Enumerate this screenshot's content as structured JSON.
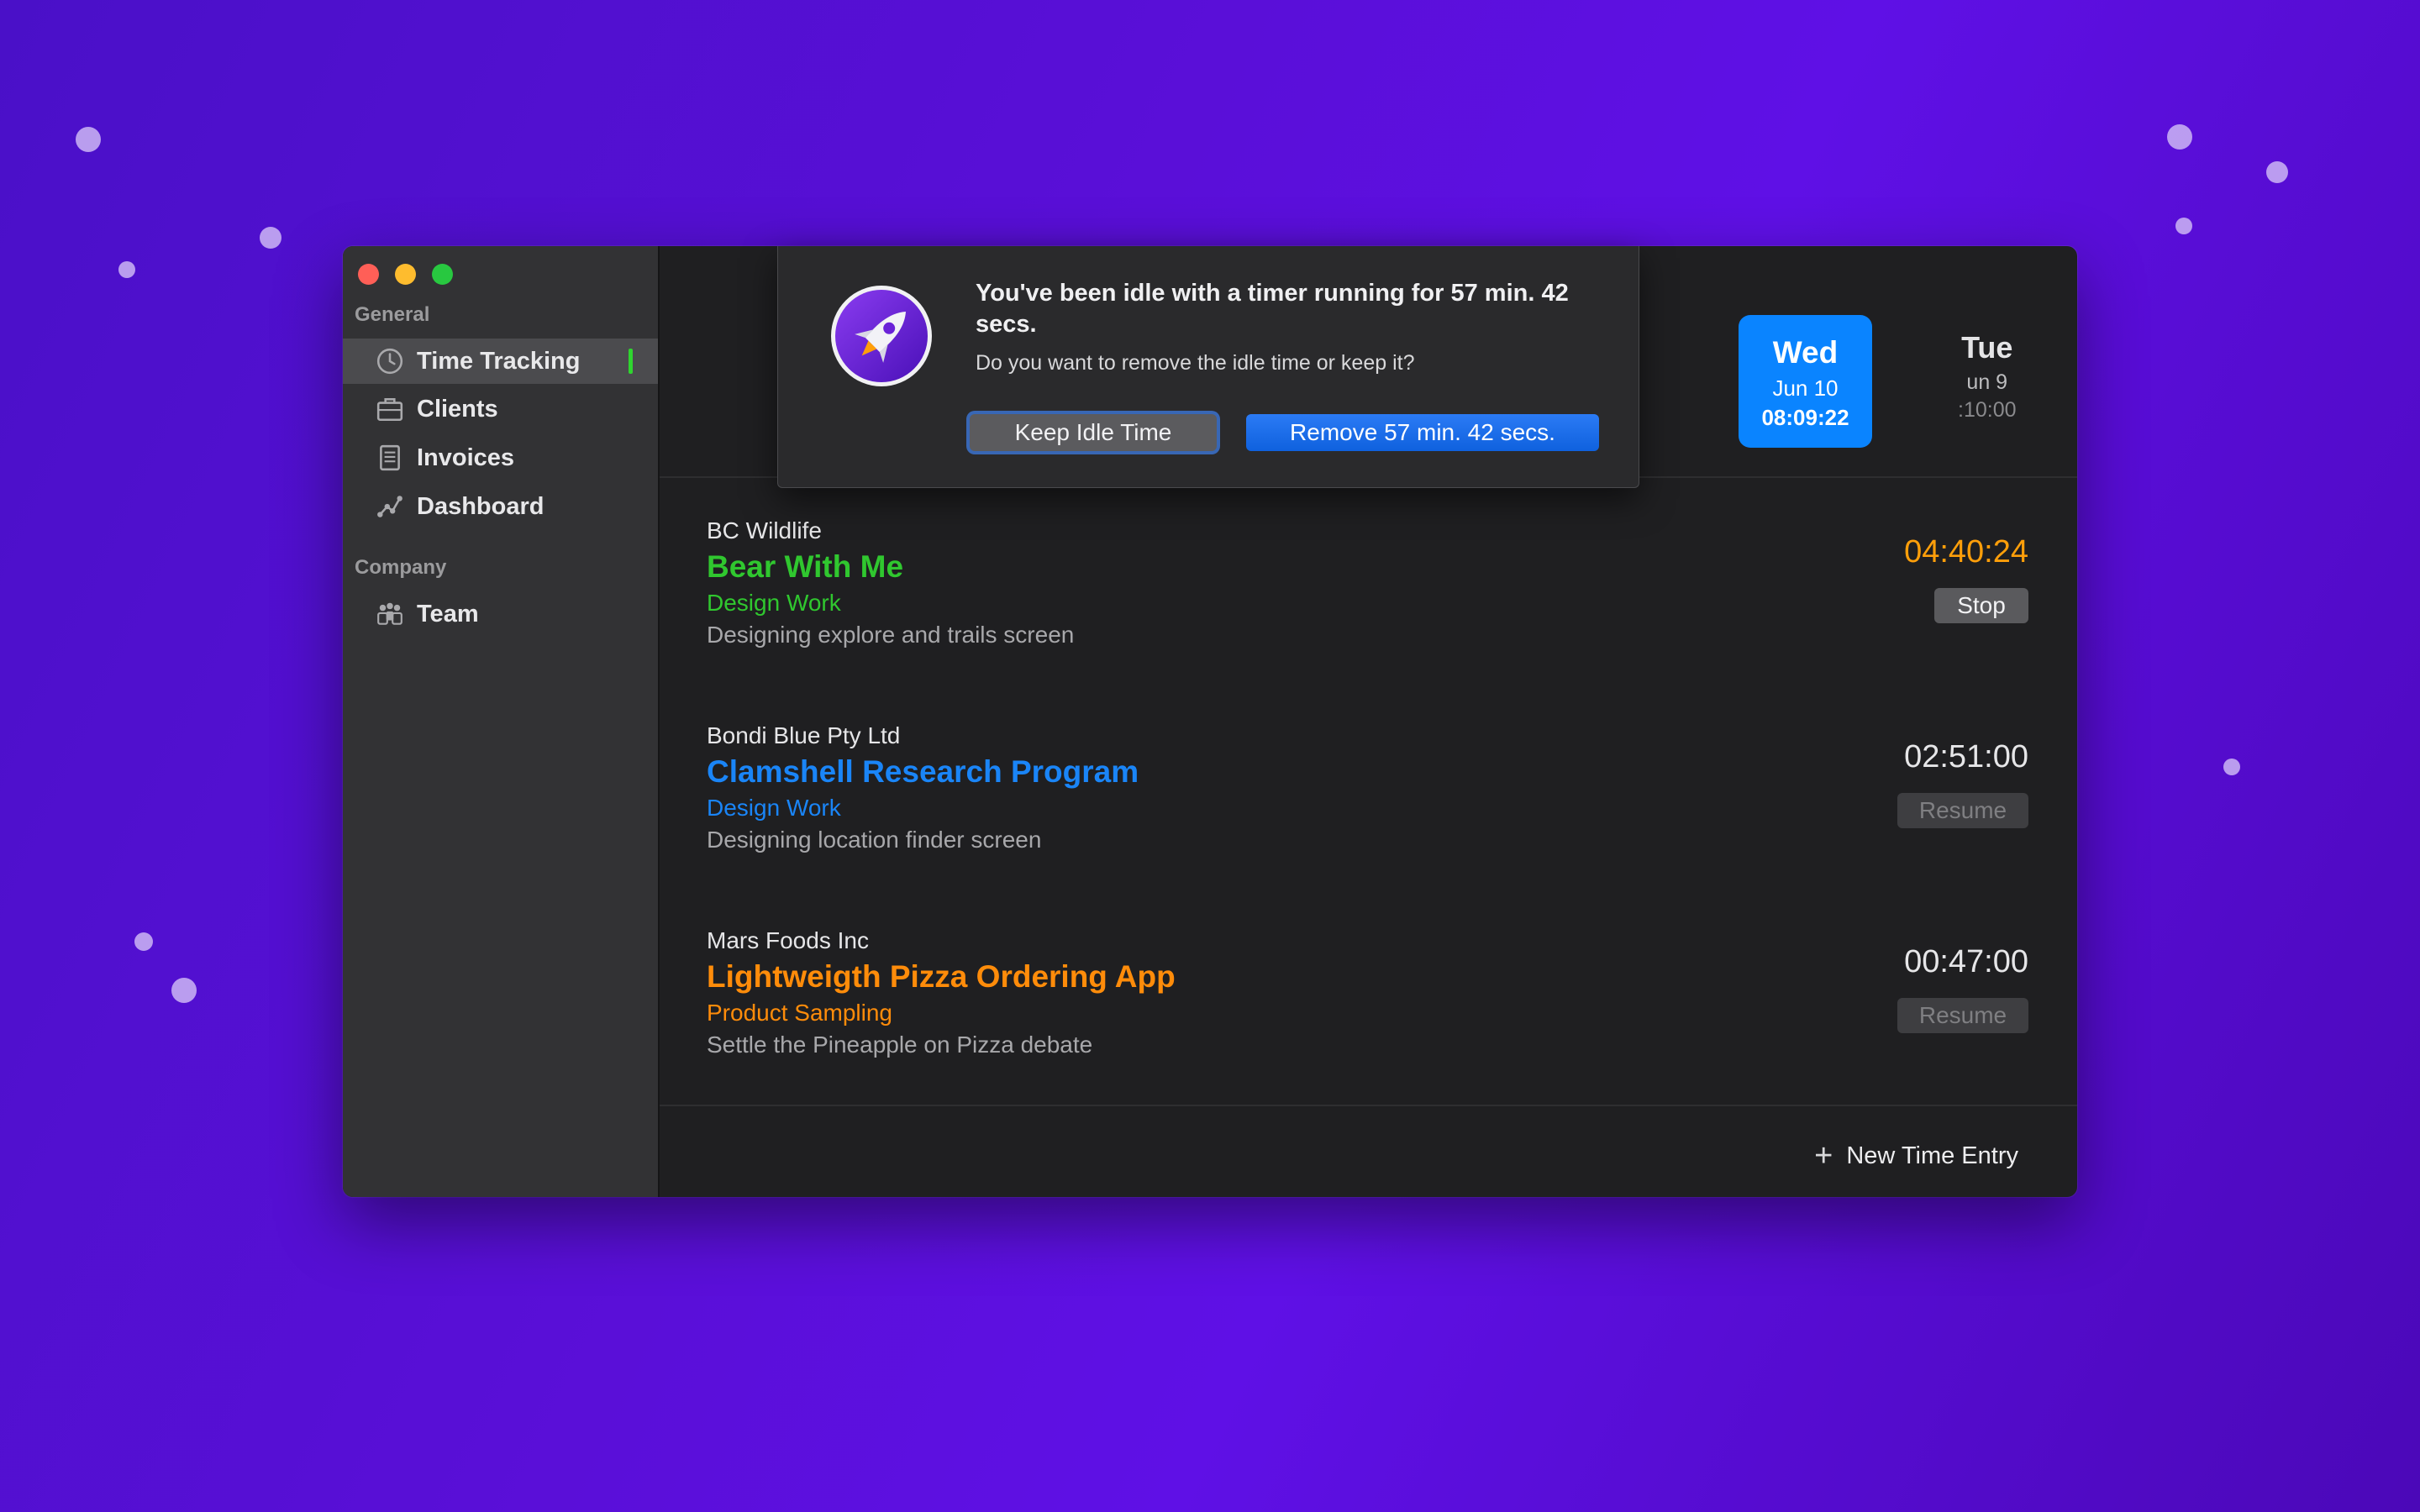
{
  "sidebar": {
    "general_label": "General",
    "company_label": "Company",
    "items": [
      {
        "label": "Time Tracking",
        "icon": "clock-icon",
        "active": true
      },
      {
        "label": "Clients",
        "icon": "briefcase-icon"
      },
      {
        "label": "Invoices",
        "icon": "invoice-icon"
      },
      {
        "label": "Dashboard",
        "icon": "chart-icon"
      },
      {
        "label": "Team",
        "icon": "team-icon"
      }
    ]
  },
  "days": {
    "tue": {
      "name": "Tue",
      "date": "un 9",
      "time": ":10:00"
    },
    "wed": {
      "name": "Wed",
      "date": "Jun 10",
      "time": "08:09:22",
      "selected": true
    }
  },
  "entries": [
    {
      "client": "BC Wildlife",
      "project": "Bear With Me",
      "task": "Design Work",
      "description": "Designing explore and trails screen",
      "time": "04:40:24",
      "action": "Stop",
      "color": "#30c72f",
      "time_color": "#ff9f0a"
    },
    {
      "client": "Bondi Blue Pty Ltd",
      "project": "Clamshell Research Program",
      "task": "Design Work",
      "description": "Designing location finder screen",
      "time": "02:51:00",
      "action": "Resume",
      "color": "#1a85f7"
    },
    {
      "client": "Mars Foods Inc",
      "project": "Lightweigth Pizza Ordering App",
      "task": "Product Sampling",
      "description": "Settle the Pineapple on Pizza debate",
      "time": "00:47:00",
      "action": "Resume",
      "color": "#ff8c0a"
    }
  ],
  "footer": {
    "new_entry_label": "New Time Entry"
  },
  "dialog": {
    "title": "You've been idle with a timer running for 57 min. 42 secs.",
    "message": "Do you want to remove the idle time or keep it?",
    "keep_label": "Keep Idle Time",
    "remove_label": "Remove 57 min. 42 secs.",
    "icon": "rocket-icon"
  }
}
